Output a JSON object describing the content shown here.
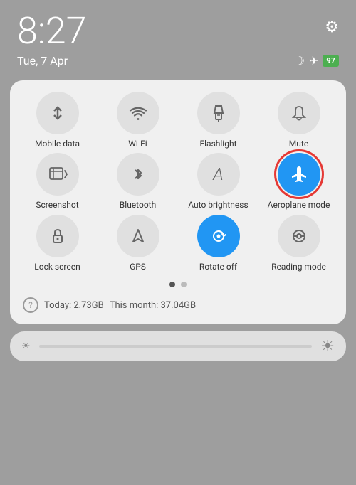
{
  "statusBar": {
    "time": "8:27",
    "date": "Tue, 7 Apr",
    "battery": "97",
    "gearIcon": "⚙",
    "moonIcon": "☽",
    "planeIcon": "✈"
  },
  "tiles": [
    {
      "id": "mobile-data",
      "label": "Mobile data",
      "icon": "↕",
      "active": false
    },
    {
      "id": "wifi",
      "label": "Wi-Fi",
      "icon": "wifi",
      "active": false
    },
    {
      "id": "flashlight",
      "label": "Flashlight",
      "icon": "flashlight",
      "active": false
    },
    {
      "id": "mute",
      "label": "Mute",
      "icon": "mute",
      "active": false
    },
    {
      "id": "screenshot",
      "label": "Screenshot",
      "icon": "screenshot",
      "active": false
    },
    {
      "id": "bluetooth",
      "label": "Bluetooth",
      "icon": "bluetooth",
      "active": false
    },
    {
      "id": "auto-brightness",
      "label": "Auto brightness",
      "icon": "A",
      "active": false
    },
    {
      "id": "aeroplane-mode",
      "label": "Aeroplane mode",
      "icon": "plane",
      "active": true
    },
    {
      "id": "lock-screen",
      "label": "Lock screen",
      "icon": "lock",
      "active": false
    },
    {
      "id": "gps",
      "label": "GPS",
      "icon": "gps",
      "active": false
    },
    {
      "id": "rotate-off",
      "label": "Rotate off",
      "icon": "rotate",
      "active": true
    },
    {
      "id": "reading-mode",
      "label": "Reading mode",
      "icon": "eye",
      "active": false
    }
  ],
  "dots": {
    "active": 0,
    "total": 2
  },
  "dataUsage": {
    "icon": "?",
    "today": "Today: 2.73GB",
    "thisMonth": "This month: 37.04GB"
  },
  "brightness": {
    "lowIcon": "☀",
    "highIcon": "☀"
  }
}
